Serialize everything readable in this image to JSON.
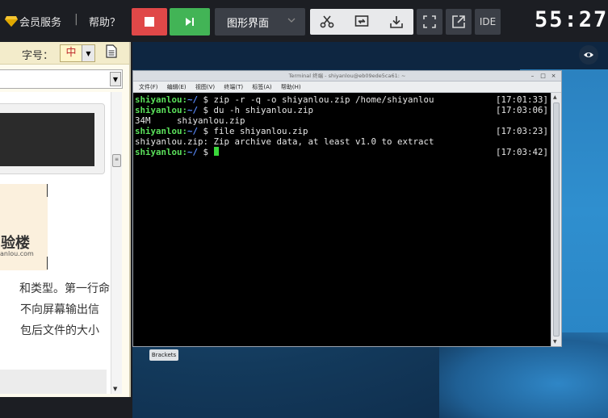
{
  "topbar": {
    "vip_label": "会员服务",
    "separator": "|",
    "help_label": "帮助？",
    "gui_label": "图形界面",
    "ide_label": "IDE",
    "timer": "55:27"
  },
  "doc": {
    "font_size_label": "字号：",
    "font_size_value": "中",
    "logo_text": "验楼",
    "logo_url": "anlou.com",
    "para": [
      "和类型。第一行命",
      "不向屏幕输出信",
      "包后文件的大小"
    ]
  },
  "terminal": {
    "title": "Terminal 终端 - shiyanlou@eb09ede5ca61: ~",
    "menu": [
      "文件(F)",
      "编辑(E)",
      "视图(V)",
      "终端(T)",
      "标签(A)",
      "帮助(H)"
    ],
    "lines": [
      {
        "prompt": "shiyanlou:",
        "path": "~/",
        "text": " $ zip -r -q -o shiyanlou.zip /home/shiyanlou",
        "time": "[17:01:33]"
      },
      {
        "prompt": "shiyanlou:",
        "path": "~/",
        "text": " $ du -h shiyanlou.zip",
        "time": "[17:03:06]"
      },
      {
        "prompt": "",
        "path": "",
        "text": "34M\tshiyanlou.zip",
        "time": ""
      },
      {
        "prompt": "shiyanlou:",
        "path": "~/",
        "text": " $ file shiyanlou.zip",
        "time": "[17:03:23]"
      },
      {
        "prompt": "",
        "path": "",
        "text": "shiyanlou.zip: Zip archive data, at least v1.0 to extract",
        "time": ""
      },
      {
        "prompt": "shiyanlou:",
        "path": "~/",
        "text": " $ ",
        "time": "[17:03:42]"
      }
    ]
  },
  "desktop": {
    "brackets_label": "Brackets"
  }
}
